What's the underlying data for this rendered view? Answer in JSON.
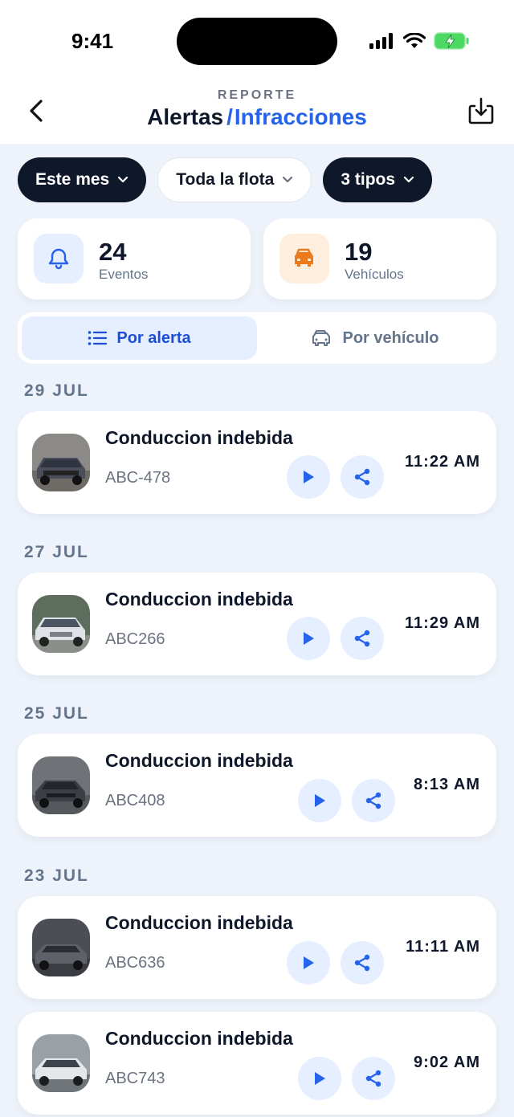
{
  "status": {
    "time": "9:41"
  },
  "header": {
    "kicker": "REPORTE",
    "title_left": "Alertas",
    "separator": "/",
    "title_right": "Infracciones"
  },
  "filters": [
    {
      "label": "Este mes",
      "style": "dark"
    },
    {
      "label": "Toda la flota",
      "style": "light"
    },
    {
      "label": "3 tipos",
      "style": "dark"
    }
  ],
  "stats": {
    "events": {
      "value": "24",
      "label": "Eventos",
      "icon": "bell-icon"
    },
    "vehicles": {
      "value": "19",
      "label": "Vehículos",
      "icon": "cars-icon"
    }
  },
  "segments": {
    "by_alert": "Por alerta",
    "by_vehicle": "Por vehículo",
    "active": "by_alert"
  },
  "groups": [
    {
      "date": "29 JUL",
      "items": [
        {
          "title": "Conduccion indebida",
          "plate": "ABC-478",
          "time": "11:22 AM"
        }
      ]
    },
    {
      "date": "27 JUL",
      "items": [
        {
          "title": "Conduccion indebida",
          "plate": "ABC266",
          "time": "11:29 AM"
        }
      ]
    },
    {
      "date": "25 JUL",
      "items": [
        {
          "title": "Conduccion indebida",
          "plate": "ABC408",
          "time": "8:13 AM"
        }
      ]
    },
    {
      "date": "23 JUL",
      "items": [
        {
          "title": "Conduccion indebida",
          "plate": "ABC636",
          "time": "11:11 AM"
        },
        {
          "title": "Conduccion indebida",
          "plate": "ABC743",
          "time": "9:02 AM"
        }
      ]
    }
  ],
  "colors": {
    "accent": "#2563eb",
    "dark": "#0f172a",
    "background": "#eef3fb",
    "vehicle_icon": "#ea7a1a"
  }
}
